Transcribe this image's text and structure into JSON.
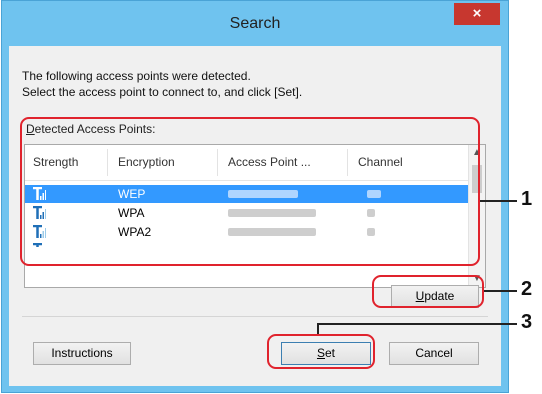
{
  "window": {
    "title": "Search",
    "close_glyph": "×"
  },
  "intro": {
    "line1": "The following access points were detected.",
    "line2": "Select the access point to connect to, and click [Set]."
  },
  "group": {
    "label_first": "D",
    "label_rest": "etected Access Points:"
  },
  "table": {
    "headers": [
      "Strength",
      "Encryption",
      "Access Point ...",
      "Channel"
    ],
    "rows": [
      {
        "strength": "signal-strength-icon",
        "encryption": "WEP",
        "access_point": "(blurred)",
        "channel": "(blurred)",
        "selected": true
      },
      {
        "strength": "signal-strength-icon",
        "encryption": "WPA",
        "access_point": "(blurred)",
        "channel": "(blurred)",
        "selected": false
      },
      {
        "strength": "signal-strength-icon",
        "encryption": "WPA2",
        "access_point": "(blurred)",
        "channel": "(blurred)",
        "selected": false
      }
    ]
  },
  "buttons": {
    "update_first": "U",
    "update_rest": "pdate",
    "instructions": "Instructions",
    "set_first": "S",
    "set_rest": "et",
    "cancel": "Cancel"
  },
  "callouts": {
    "one": "1",
    "two": "2",
    "three": "3"
  },
  "colors": {
    "highlight": "#3399ff",
    "callout": "#e0232d",
    "titlebar": "#6fc3ef",
    "close": "#c7372f"
  }
}
